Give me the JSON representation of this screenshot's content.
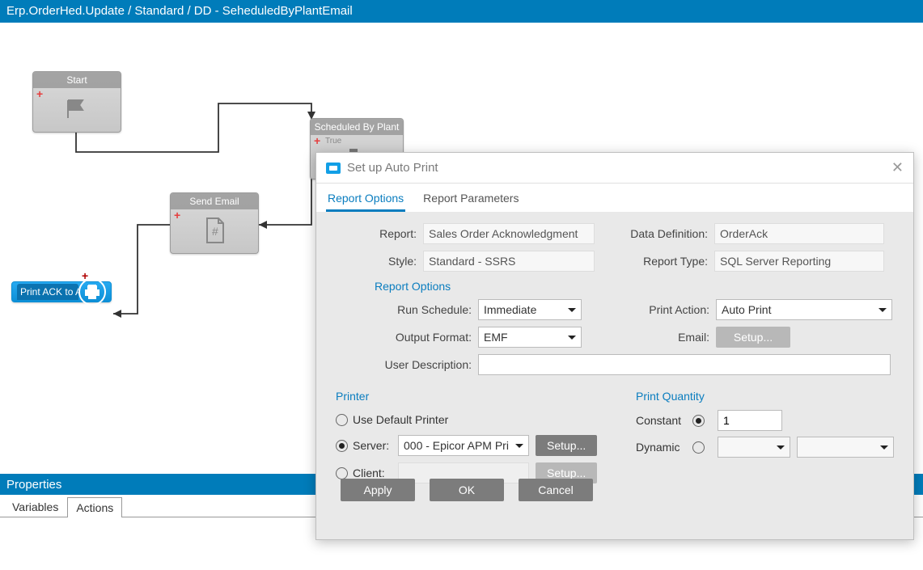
{
  "titlebar": "Erp.OrderHed.Update / Standard / DD - SeheduledByPlantEmail",
  "nodes": {
    "start": "Start",
    "scheduled": "Scheduled By Plant",
    "sched_badge": "True",
    "sendemail": "Send Email",
    "printack": "Print ACK to APM"
  },
  "properties": {
    "header": "Properties",
    "tab_vars": "Variables",
    "tab_actions": "Actions"
  },
  "dialog": {
    "title": "Set up Auto Print",
    "tab1": "Report Options",
    "tab2": "Report Parameters",
    "report_lbl": "Report:",
    "report_val": "Sales Order Acknowledgment",
    "datadef_lbl": "Data Definition:",
    "datadef_val": "OrderAck",
    "style_lbl": "Style:",
    "style_val": "Standard - SSRS",
    "reptype_lbl": "Report Type:",
    "reptype_val": "SQL Server Reporting",
    "section_ro": "Report Options",
    "runsched_lbl": "Run Schedule:",
    "runsched_val": "Immediate",
    "printaction_lbl": "Print Action:",
    "printaction_val": "Auto Print",
    "outfmt_lbl": "Output Format:",
    "outfmt_val": "EMF",
    "email_lbl": "Email:",
    "email_btn": "Setup...",
    "userdesc_lbl": "User Description:",
    "userdesc_val": "",
    "section_printer": "Printer",
    "opt_default": "Use Default Printer",
    "opt_server": "Server:",
    "server_val": "000 - Epicor APM Pri",
    "server_btn": "Setup...",
    "opt_client": "Client:",
    "client_btn": "Setup...",
    "section_qty": "Print Quantity",
    "qty_const": "Constant",
    "qty_const_val": "1",
    "qty_dyn": "Dynamic",
    "btn_apply": "Apply",
    "btn_ok": "OK",
    "btn_cancel": "Cancel"
  }
}
